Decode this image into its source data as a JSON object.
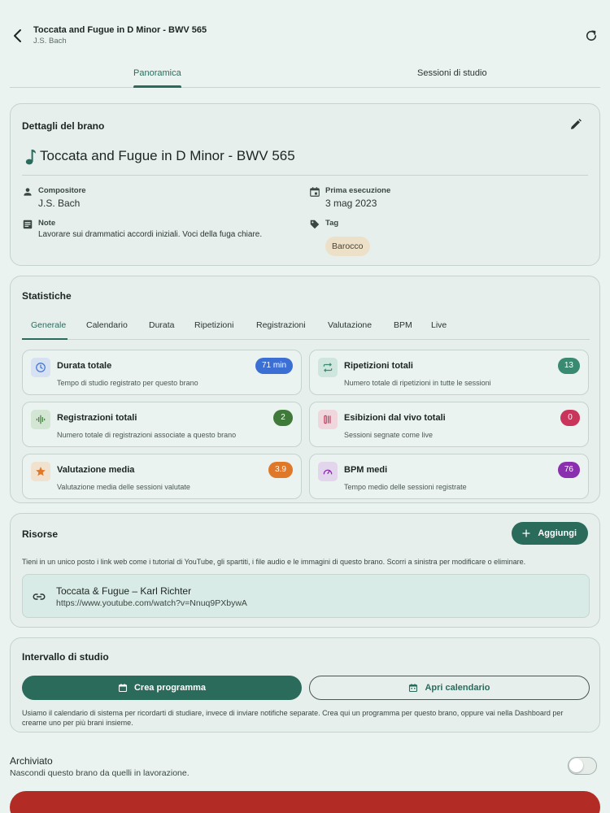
{
  "appbar": {
    "title": "Toccata and Fugue in D Minor - BWV 565",
    "subtitle": "J.S. Bach"
  },
  "main_tabs": [
    {
      "label": "Panoramica",
      "active": true
    },
    {
      "label": "Sessioni di studio",
      "active": false
    }
  ],
  "details": {
    "card_title": "Dettagli del brano",
    "piece_title": "Toccata and Fugue in D Minor - BWV 565",
    "composer_label": "Compositore",
    "composer_value": "J.S. Bach",
    "first_performance_label": "Prima esecuzione",
    "first_performance_value": "3 mag 2023",
    "notes_label": "Note",
    "notes_value": "Lavorare sui drammatici accordi iniziali. Voci della fuga chiare.",
    "tag_label": "Tag",
    "tag_value": "Barocco"
  },
  "stats": {
    "card_title": "Statistiche",
    "tabs": [
      "Generale",
      "Calendario",
      "Durata",
      "Ripetizioni",
      "Registrazioni",
      "Valutazione",
      "BPM",
      "Live"
    ],
    "items": [
      {
        "title": "Durata totale",
        "desc": "Tempo di studio registrato per questo brano",
        "badge": "71 min",
        "icon": "clock-icon",
        "color": "#3b6fd4",
        "bg": "#d6e2f2"
      },
      {
        "title": "Ripetizioni totali",
        "desc": "Numero totale di ripetizioni in tutte le sessioni",
        "badge": "13",
        "icon": "repeat-icon",
        "color": "#3a8a72",
        "bg": "#cfe6de"
      },
      {
        "title": "Registrazioni totali",
        "desc": "Numero totale di registrazioni associate a questo brano",
        "badge": "2",
        "icon": "waveform-icon",
        "color": "#3f7a3a",
        "bg": "#d3e6d4"
      },
      {
        "title": "Esibizioni dal vivo totali",
        "desc": "Sessioni segnate come live",
        "badge": "0",
        "icon": "guitar-icon",
        "color": "#c9345a",
        "bg": "#f0d6dd"
      },
      {
        "title": "Valutazione media",
        "desc": "Valutazione media delle sessioni valutate",
        "badge": "3.9",
        "icon": "star-icon",
        "color": "#e0782a",
        "bg": "#f1e1cf"
      },
      {
        "title": "BPM medi",
        "desc": "Tempo medio delle sessioni registrate",
        "badge": "76",
        "icon": "speed-icon",
        "color": "#8a2fae",
        "bg": "#e3d6ec"
      }
    ]
  },
  "resources": {
    "card_title": "Risorse",
    "add_label": "Aggiungi",
    "desc": "Tieni in un unico posto i link web come i tutorial di YouTube, gli spartiti, i file audio e le immagini di questo brano. Scorri a sinistra per modificare o eliminare.",
    "items": [
      {
        "title": "Toccata & Fugue – Karl Richter",
        "url": "https://www.youtube.com/watch?v=Nnuq9PXbywA"
      }
    ]
  },
  "schedule": {
    "card_title": "Intervallo di studio",
    "create_label": "Crea programma",
    "calendar_label": "Apri calendario",
    "desc": "Usiamo il calendario di sistema per ricordarti di studiare, invece di inviare notifiche separate. Crea qui un programma per questo brano, oppure vai nella Dashboard per crearne uno per più brani insieme."
  },
  "archive": {
    "title": "Archiviato",
    "subtitle": "Nascondi questo brano da quelli in lavorazione.",
    "enabled": false
  }
}
